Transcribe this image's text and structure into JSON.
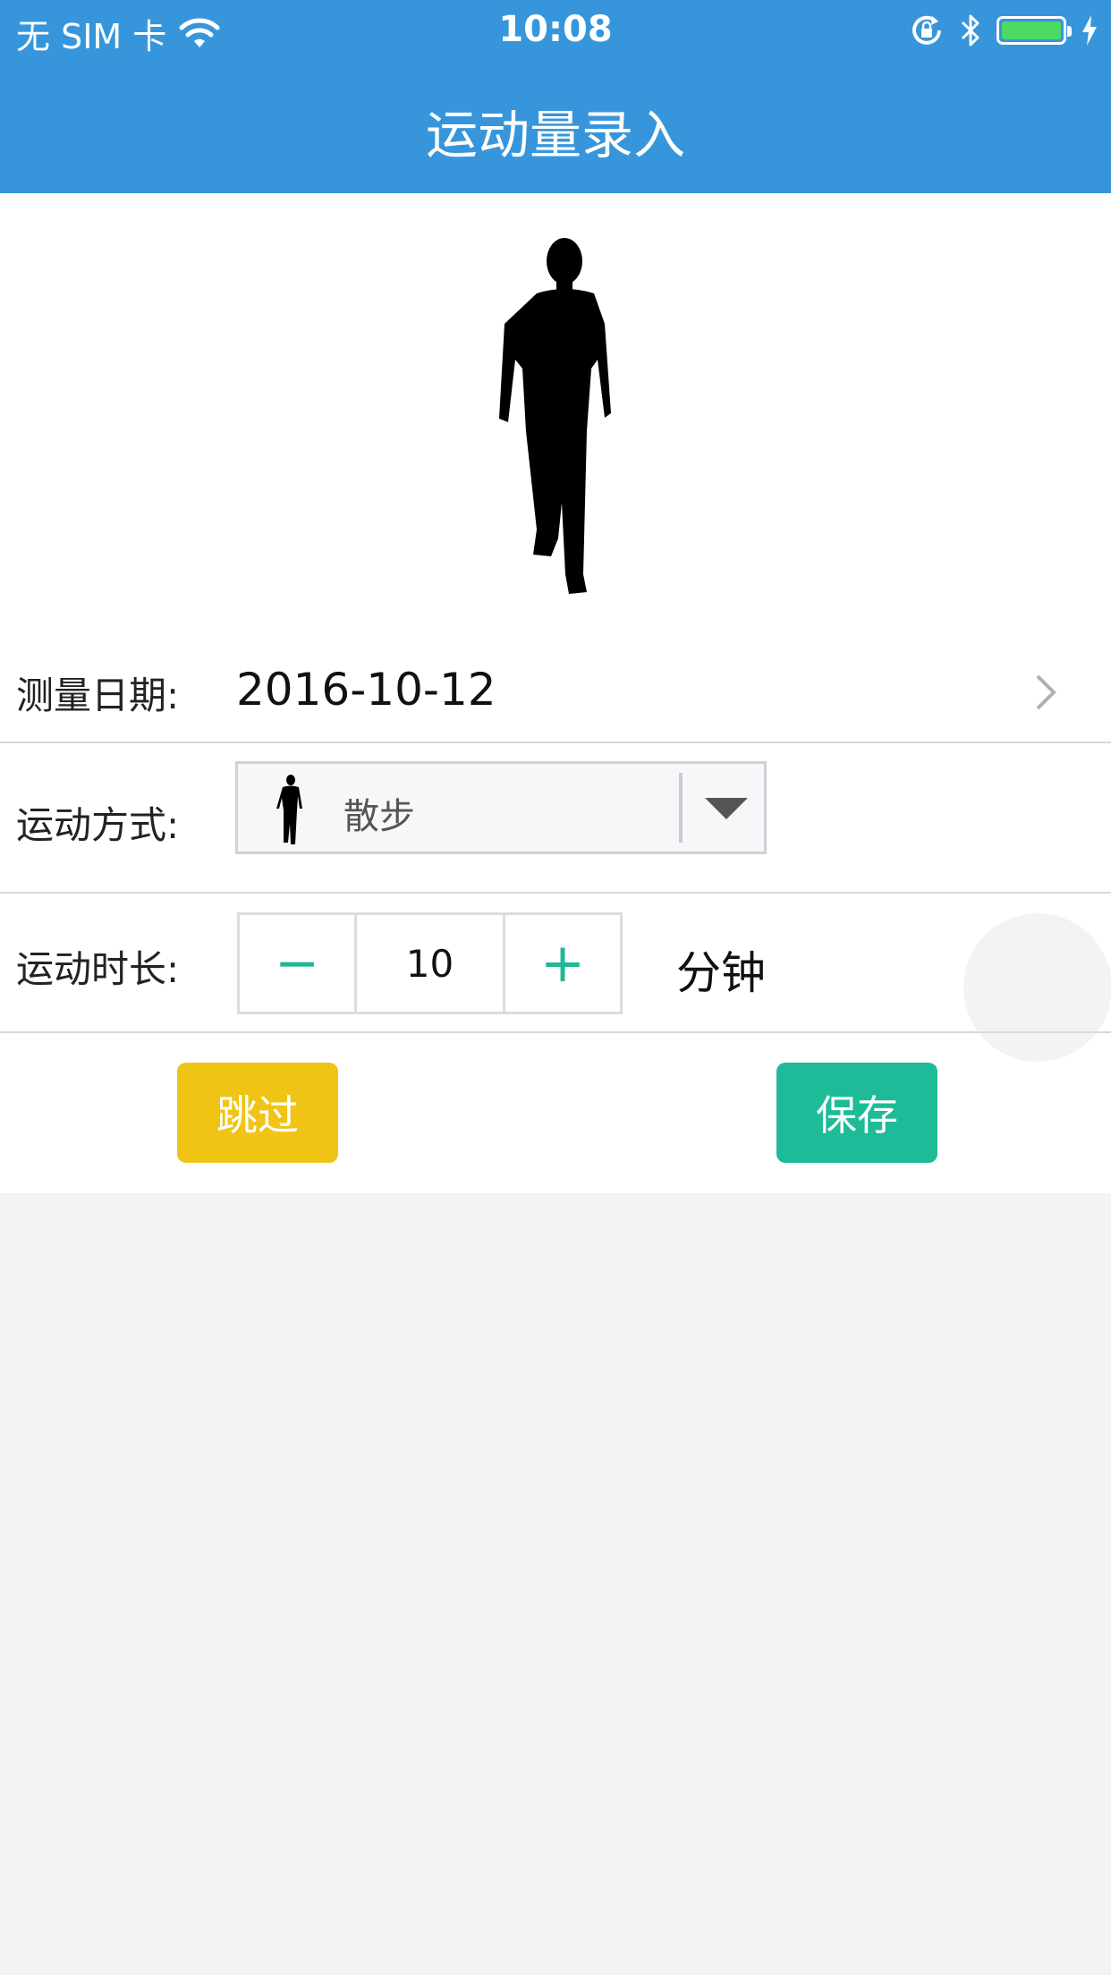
{
  "status_bar": {
    "carrier": "无 SIM 卡",
    "time": "10:08",
    "battery_level": 1.0,
    "battery_color": "#4cd964"
  },
  "nav": {
    "title": "运动量录入",
    "background": "#3796db"
  },
  "hero": {
    "icon": "walking-person-silhouette-icon"
  },
  "form": {
    "date": {
      "label": "测量日期:",
      "value": "2016-10-12",
      "chevron_icon": "chevron-right-icon"
    },
    "exercise": {
      "label": "运动方式:",
      "selected": "散步",
      "icon": "walking-person-icon",
      "caret_icon": "caret-down-icon"
    },
    "duration": {
      "label": "运动时长:",
      "minus": "−",
      "value": "10",
      "plus": "+",
      "unit": "分钟"
    }
  },
  "actions": {
    "skip": "跳过",
    "save": "保存",
    "skip_color": "#f0c414",
    "save_color": "#1ebb98"
  }
}
